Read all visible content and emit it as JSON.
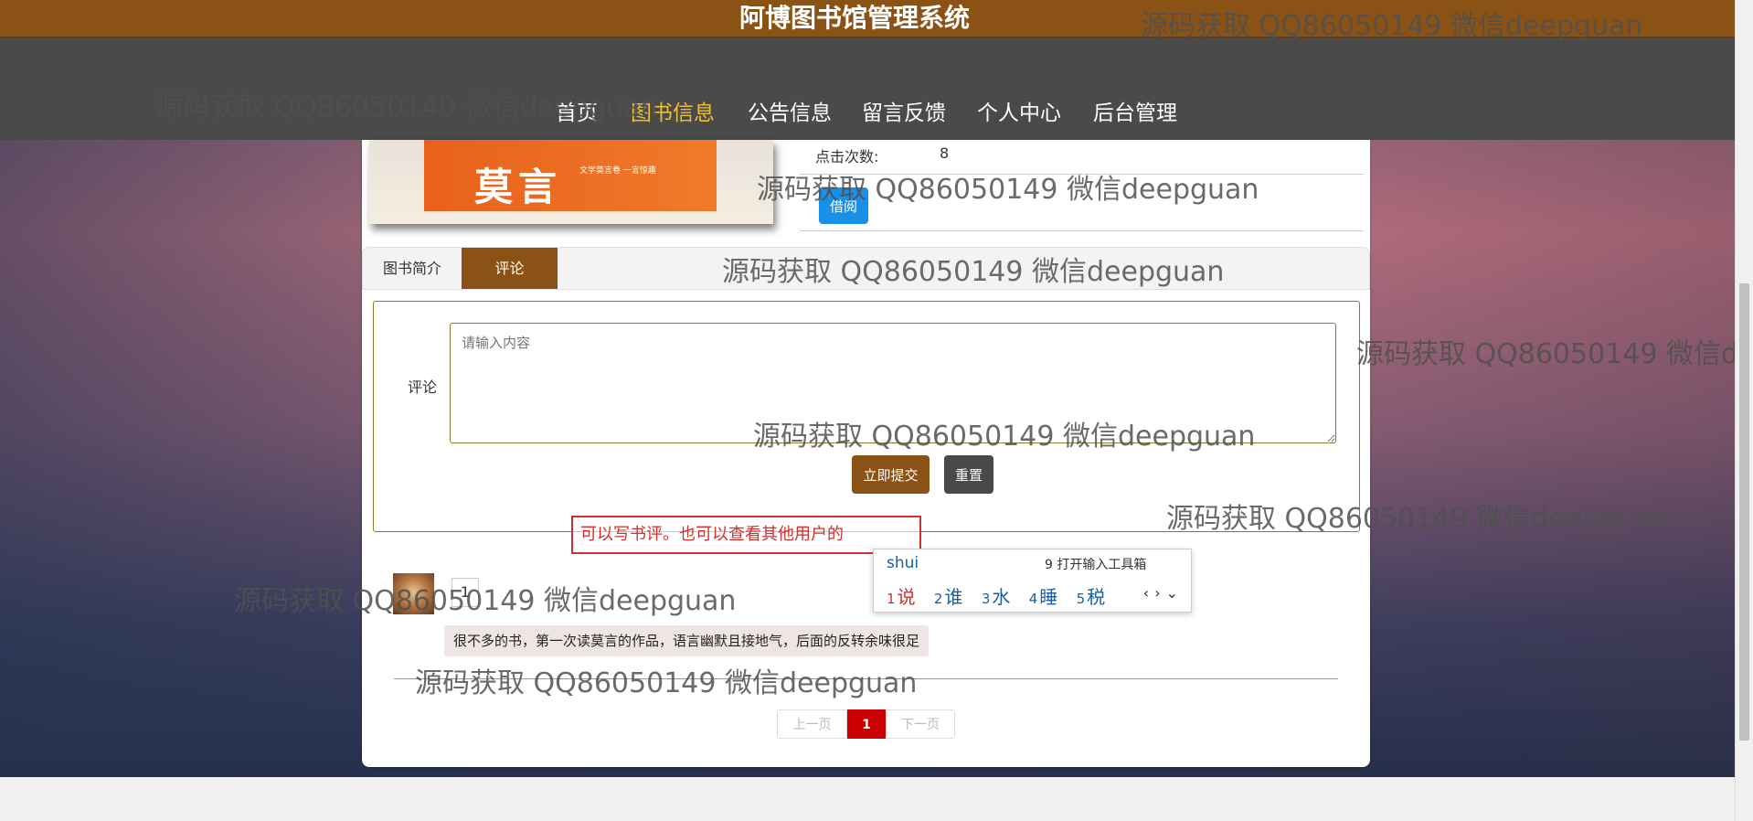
{
  "header": {
    "title": "阿博图书馆管理系统"
  },
  "nav": {
    "items": [
      {
        "label": "首页"
      },
      {
        "label": "图书信息"
      },
      {
        "label": "公告信息"
      },
      {
        "label": "留言反馈"
      },
      {
        "label": "个人中心"
      },
      {
        "label": "后台管理"
      }
    ],
    "active_index": 1
  },
  "book": {
    "cover_title": "莫言",
    "cover_small": "文学莫言卷 一言惊趣",
    "clicks_label": "点击次数:",
    "clicks_value": "8",
    "borrow_label": "借阅"
  },
  "tabs": {
    "intro": "图书简介",
    "comment": "评论"
  },
  "form": {
    "comment_label": "评论",
    "placeholder": "请输入内容",
    "submit_label": "立即提交",
    "reset_label": "重置"
  },
  "annotation": "可以写书评。也可以查看其他用户的",
  "ime": {
    "pinyin": "shui",
    "toolbox": "9 打开输入工具箱",
    "candidates": [
      {
        "n": "1",
        "c": "说"
      },
      {
        "n": "2",
        "c": "谁"
      },
      {
        "n": "3",
        "c": "水"
      },
      {
        "n": "4",
        "c": "睡"
      },
      {
        "n": "5",
        "c": "税"
      }
    ]
  },
  "comment": {
    "user": "1",
    "text": "很不多的书，第一次读莫言的作品，语言幽默且接地气，后面的反转余味很足"
  },
  "pager": {
    "prev": "上一页",
    "current": "1",
    "next": "下一页"
  },
  "watermark": "源码获取 QQ86050149 微信deepguan",
  "colors": {
    "brand": "#8a5214",
    "nav_bg": "#4a4a4a",
    "active_nav": "#f0c030",
    "borrow": "#1a8fe8",
    "page_current": "#cc0000"
  }
}
